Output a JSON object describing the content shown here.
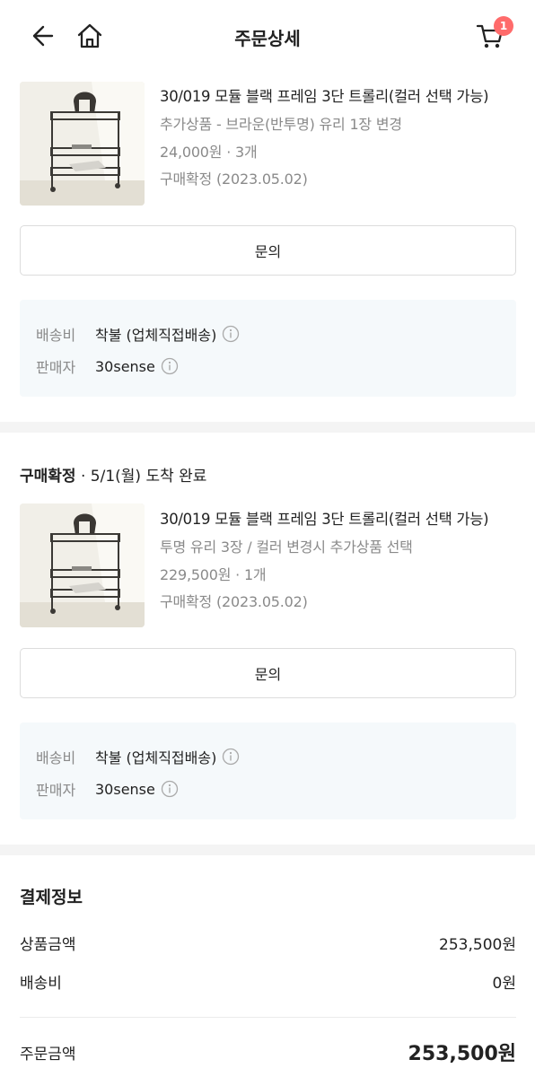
{
  "header": {
    "title": "주문상세",
    "cart_count": "1"
  },
  "item1": {
    "name": "30/019 모듈 블랙 프레임 3단 트롤리(컬러 선택 가능)",
    "option": "추가상품 - 브라운(반투명) 유리 1장 변경",
    "price_qty": "24,000원 · 3개",
    "confirm": "구매확정 (2023.05.02)",
    "inquiry_button": "문의",
    "shipping_label": "배송비",
    "shipping_value": "착불 (업체직접배송)",
    "seller_label": "판매자",
    "seller_value": "30sense"
  },
  "group2_status": {
    "title": "구매확정",
    "detail": " · 5/1(월) 도착 완료"
  },
  "item2": {
    "name": "30/019 모듈 블랙 프레임 3단 트롤리(컬러 선택 가능)",
    "option": "투명 유리 3장 / 컬러 변경시 추가상품 선택",
    "price_qty": "229,500원 · 1개",
    "confirm": "구매확정 (2023.05.02)",
    "inquiry_button": "문의",
    "shipping_label": "배송비",
    "shipping_value": "착불 (업체직접배송)",
    "seller_label": "판매자",
    "seller_value": "30sense"
  },
  "payment": {
    "title": "결제정보",
    "rows": [
      {
        "label": "상품금액",
        "value": "253,500원"
      },
      {
        "label": "배송비",
        "value": "0원"
      }
    ],
    "total_label": "주문금액",
    "total_value": "253,500원"
  },
  "colors": {
    "accent_badge": "#ff6b6b",
    "info_bg": "#f5f9fb",
    "muted_text": "#8a8a8a"
  }
}
